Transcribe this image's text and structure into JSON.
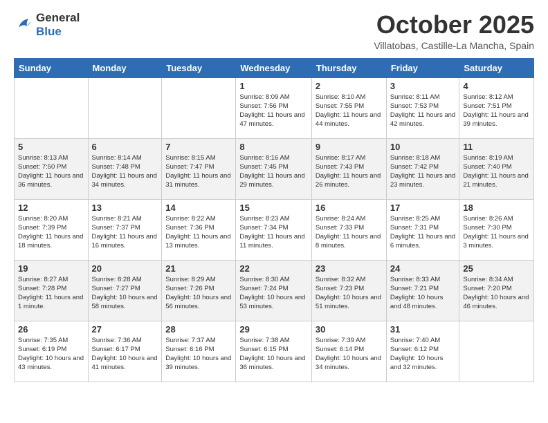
{
  "logo": {
    "general": "General",
    "blue": "Blue"
  },
  "header": {
    "month": "October 2025",
    "location": "Villatobas, Castille-La Mancha, Spain"
  },
  "weekdays": [
    "Sunday",
    "Monday",
    "Tuesday",
    "Wednesday",
    "Thursday",
    "Friday",
    "Saturday"
  ],
  "weeks": [
    [
      {
        "day": "",
        "info": ""
      },
      {
        "day": "",
        "info": ""
      },
      {
        "day": "",
        "info": ""
      },
      {
        "day": "1",
        "info": "Sunrise: 8:09 AM\nSunset: 7:56 PM\nDaylight: 11 hours and 47 minutes."
      },
      {
        "day": "2",
        "info": "Sunrise: 8:10 AM\nSunset: 7:55 PM\nDaylight: 11 hours and 44 minutes."
      },
      {
        "day": "3",
        "info": "Sunrise: 8:11 AM\nSunset: 7:53 PM\nDaylight: 11 hours and 42 minutes."
      },
      {
        "day": "4",
        "info": "Sunrise: 8:12 AM\nSunset: 7:51 PM\nDaylight: 11 hours and 39 minutes."
      }
    ],
    [
      {
        "day": "5",
        "info": "Sunrise: 8:13 AM\nSunset: 7:50 PM\nDaylight: 11 hours and 36 minutes."
      },
      {
        "day": "6",
        "info": "Sunrise: 8:14 AM\nSunset: 7:48 PM\nDaylight: 11 hours and 34 minutes."
      },
      {
        "day": "7",
        "info": "Sunrise: 8:15 AM\nSunset: 7:47 PM\nDaylight: 11 hours and 31 minutes."
      },
      {
        "day": "8",
        "info": "Sunrise: 8:16 AM\nSunset: 7:45 PM\nDaylight: 11 hours and 29 minutes."
      },
      {
        "day": "9",
        "info": "Sunrise: 8:17 AM\nSunset: 7:43 PM\nDaylight: 11 hours and 26 minutes."
      },
      {
        "day": "10",
        "info": "Sunrise: 8:18 AM\nSunset: 7:42 PM\nDaylight: 11 hours and 23 minutes."
      },
      {
        "day": "11",
        "info": "Sunrise: 8:19 AM\nSunset: 7:40 PM\nDaylight: 11 hours and 21 minutes."
      }
    ],
    [
      {
        "day": "12",
        "info": "Sunrise: 8:20 AM\nSunset: 7:39 PM\nDaylight: 11 hours and 18 minutes."
      },
      {
        "day": "13",
        "info": "Sunrise: 8:21 AM\nSunset: 7:37 PM\nDaylight: 11 hours and 16 minutes."
      },
      {
        "day": "14",
        "info": "Sunrise: 8:22 AM\nSunset: 7:36 PM\nDaylight: 11 hours and 13 minutes."
      },
      {
        "day": "15",
        "info": "Sunrise: 8:23 AM\nSunset: 7:34 PM\nDaylight: 11 hours and 11 minutes."
      },
      {
        "day": "16",
        "info": "Sunrise: 8:24 AM\nSunset: 7:33 PM\nDaylight: 11 hours and 8 minutes."
      },
      {
        "day": "17",
        "info": "Sunrise: 8:25 AM\nSunset: 7:31 PM\nDaylight: 11 hours and 6 minutes."
      },
      {
        "day": "18",
        "info": "Sunrise: 8:26 AM\nSunset: 7:30 PM\nDaylight: 11 hours and 3 minutes."
      }
    ],
    [
      {
        "day": "19",
        "info": "Sunrise: 8:27 AM\nSunset: 7:28 PM\nDaylight: 11 hours and 1 minute."
      },
      {
        "day": "20",
        "info": "Sunrise: 8:28 AM\nSunset: 7:27 PM\nDaylight: 10 hours and 58 minutes."
      },
      {
        "day": "21",
        "info": "Sunrise: 8:29 AM\nSunset: 7:26 PM\nDaylight: 10 hours and 56 minutes."
      },
      {
        "day": "22",
        "info": "Sunrise: 8:30 AM\nSunset: 7:24 PM\nDaylight: 10 hours and 53 minutes."
      },
      {
        "day": "23",
        "info": "Sunrise: 8:32 AM\nSunset: 7:23 PM\nDaylight: 10 hours and 51 minutes."
      },
      {
        "day": "24",
        "info": "Sunrise: 8:33 AM\nSunset: 7:21 PM\nDaylight: 10 hours and 48 minutes."
      },
      {
        "day": "25",
        "info": "Sunrise: 8:34 AM\nSunset: 7:20 PM\nDaylight: 10 hours and 46 minutes."
      }
    ],
    [
      {
        "day": "26",
        "info": "Sunrise: 7:35 AM\nSunset: 6:19 PM\nDaylight: 10 hours and 43 minutes."
      },
      {
        "day": "27",
        "info": "Sunrise: 7:36 AM\nSunset: 6:17 PM\nDaylight: 10 hours and 41 minutes."
      },
      {
        "day": "28",
        "info": "Sunrise: 7:37 AM\nSunset: 6:16 PM\nDaylight: 10 hours and 39 minutes."
      },
      {
        "day": "29",
        "info": "Sunrise: 7:38 AM\nSunset: 6:15 PM\nDaylight: 10 hours and 36 minutes."
      },
      {
        "day": "30",
        "info": "Sunrise: 7:39 AM\nSunset: 6:14 PM\nDaylight: 10 hours and 34 minutes."
      },
      {
        "day": "31",
        "info": "Sunrise: 7:40 AM\nSunset: 6:12 PM\nDaylight: 10 hours and 32 minutes."
      },
      {
        "day": "",
        "info": ""
      }
    ]
  ]
}
